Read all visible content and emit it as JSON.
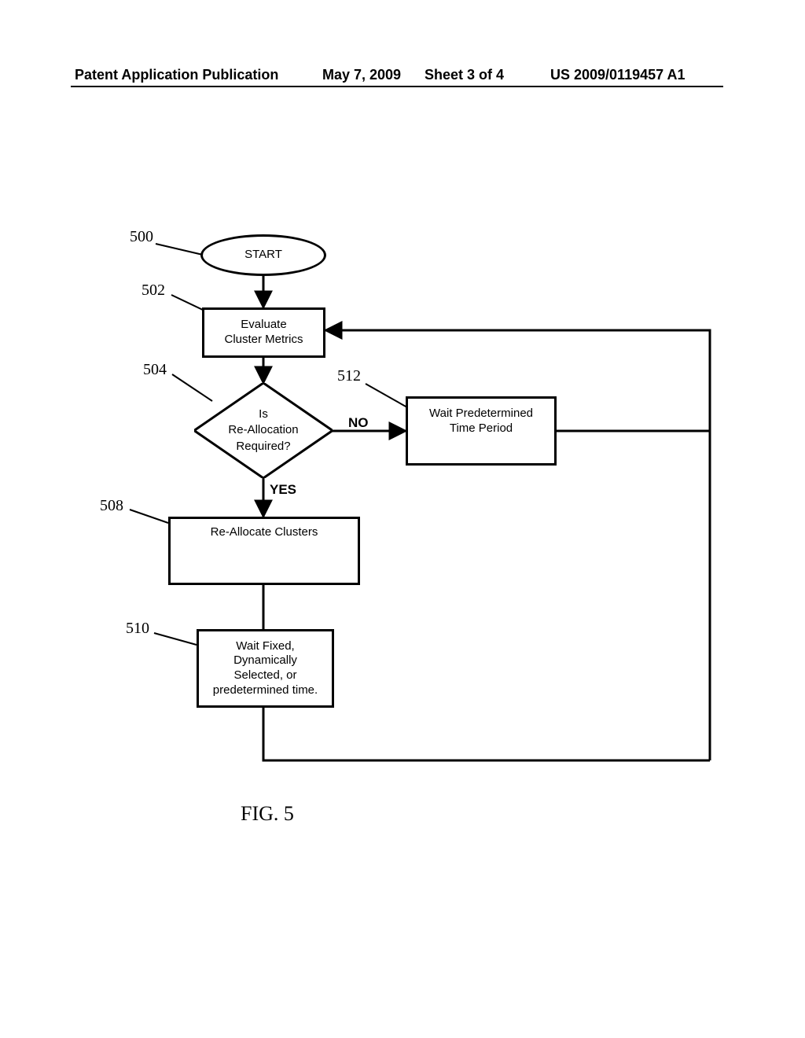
{
  "header": {
    "left": "Patent Application Publication",
    "date": "May 7, 2009",
    "sheet": "Sheet 3 of 4",
    "pubno": "US 2009/0119457 A1"
  },
  "labels": {
    "n500": "500",
    "n502": "502",
    "n504": "504",
    "n508": "508",
    "n510": "510",
    "n512": "512"
  },
  "nodes": {
    "start": "START",
    "eval": "Evaluate\nCluster Metrics",
    "decision": "Is\nRe-Allocation\nRequired?",
    "wait_pd": "Wait Predetermined\nTime Period",
    "realloc": "Re-Allocate Clusters",
    "wait_fixed": "Wait Fixed,\nDynamically\nSelected, or\npredetermined time."
  },
  "branches": {
    "no": "NO",
    "yes": "YES"
  },
  "figure": "FIG. 5"
}
